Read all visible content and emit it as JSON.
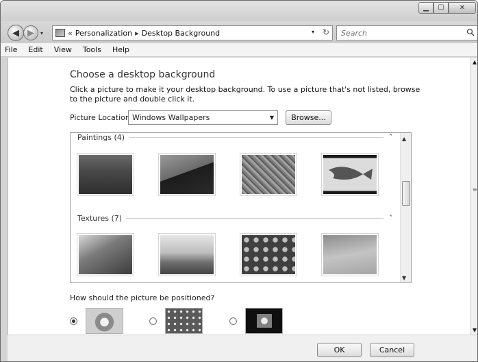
{
  "window": {
    "minimize_glyph": "▁",
    "maximize_glyph": "☐",
    "close_glyph": "✕"
  },
  "nav": {
    "back_glyph": "◀",
    "forward_glyph": "▶",
    "dropdown_glyph": "▾"
  },
  "address": {
    "prefix": "«",
    "separator": "▸",
    "crumbs": [
      "Personalization",
      "Desktop Background"
    ],
    "dropdown_glyph": "▾",
    "refresh_glyph": "↻"
  },
  "search": {
    "placeholder": "Search"
  },
  "menu": {
    "items": [
      "File",
      "Edit",
      "View",
      "Tools",
      "Help"
    ]
  },
  "page": {
    "heading": "Choose a desktop background",
    "description": "Click a picture to make it your desktop background. To use a picture that's not listed, browse to the picture and double click it.",
    "location_label": "Picture Location",
    "location_value": "Windows Wallpapers",
    "browse_label": "Browse..."
  },
  "gallery": {
    "groups": [
      {
        "title": "Paintings (4)",
        "collapse_glyph": "˄"
      },
      {
        "title": "Textures (7)",
        "collapse_glyph": "˄"
      }
    ]
  },
  "position": {
    "label": "How should the picture be positioned?",
    "selected": "fill"
  },
  "buttons": {
    "ok": "OK",
    "cancel": "Cancel"
  },
  "icons": {
    "search": "search-icon",
    "back": "back-arrow-icon",
    "forward": "forward-arrow-icon",
    "address": "control-panel-icon"
  }
}
